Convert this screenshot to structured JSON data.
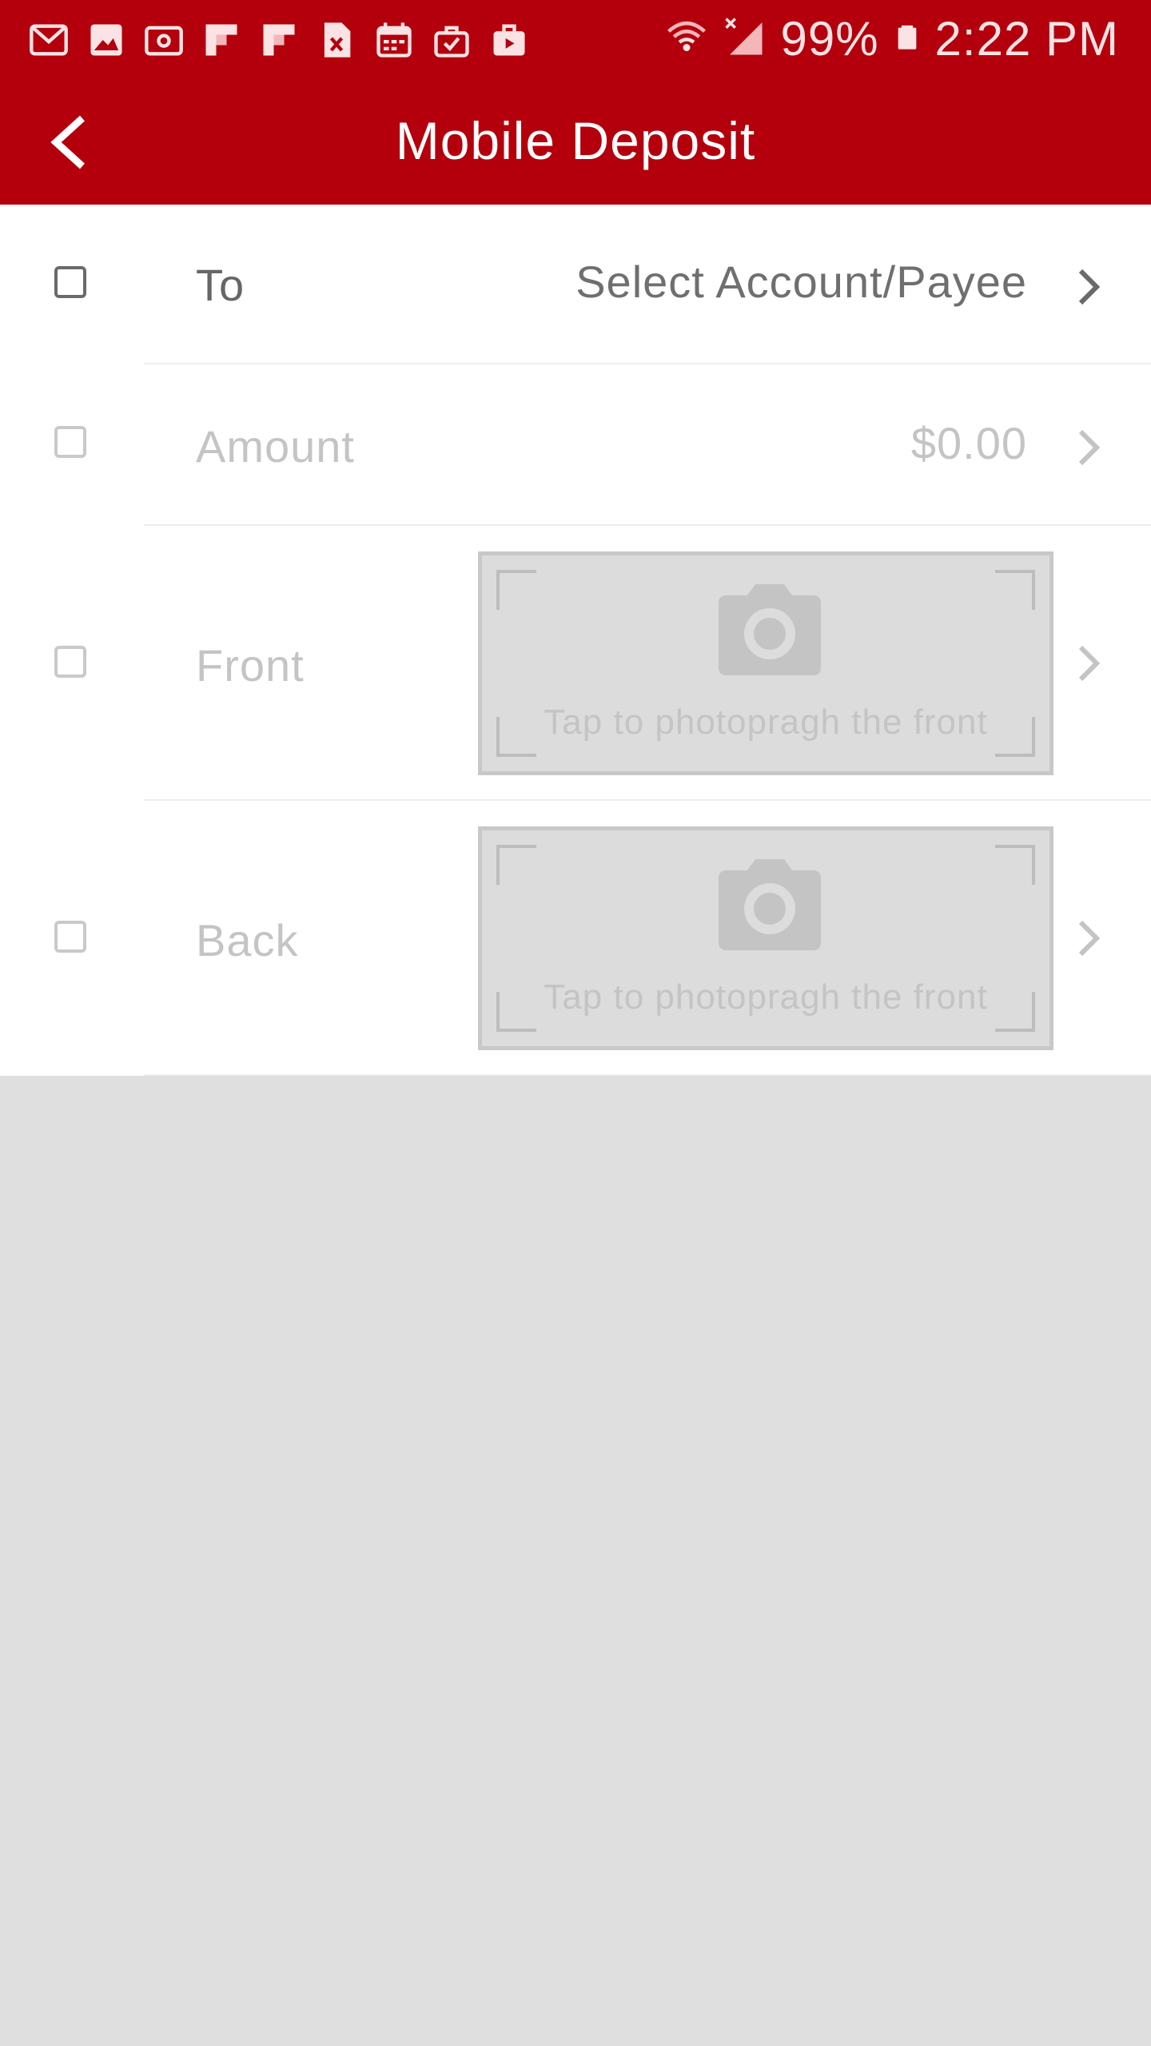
{
  "status_bar": {
    "notification_icons": [
      "gmail-icon",
      "gallery-icon",
      "email-icon",
      "flipboard-icon",
      "flipboard-icon",
      "excel-icon",
      "calendar-icon",
      "briefcase-check-icon",
      "video-bag-icon"
    ],
    "battery": "99%",
    "time": "2:22 PM"
  },
  "app_bar": {
    "title": "Mobile Deposit",
    "back_icon": "back-arrow-icon"
  },
  "form": {
    "to": {
      "label": "To",
      "value": "Select Account/Payee"
    },
    "amount": {
      "label": "Amount",
      "value": "$0.00"
    },
    "front": {
      "label": "Front",
      "hint": "Tap to photopragh the front"
    },
    "back": {
      "label": "Back",
      "hint": "Tap to photopragh the front"
    }
  },
  "colors": {
    "brand_red": "#b3000c",
    "background_gray": "#dfdfdf",
    "active_text": "#666666",
    "disabled_text": "#c4c4c4"
  }
}
